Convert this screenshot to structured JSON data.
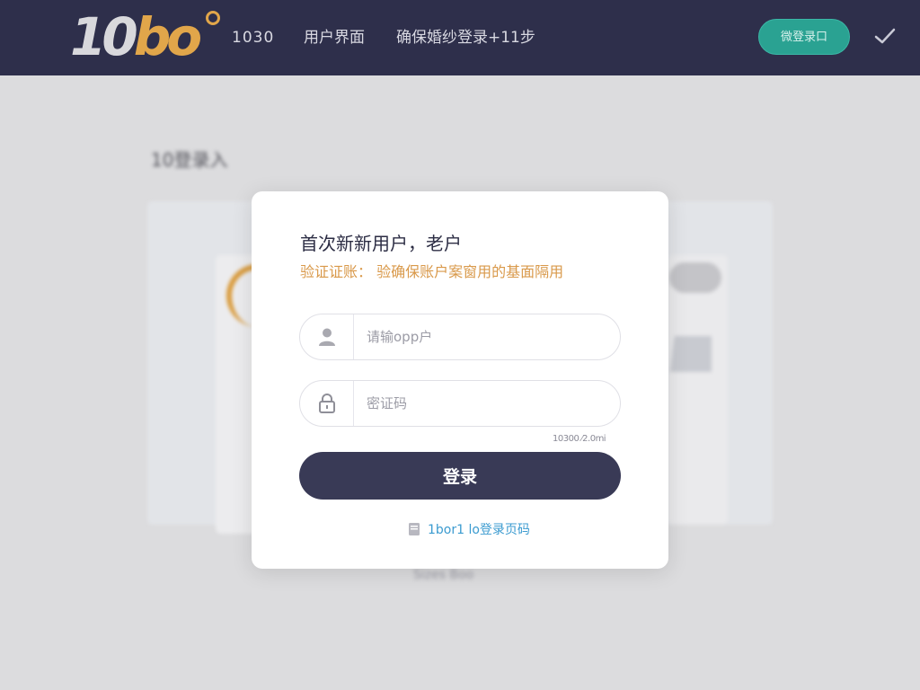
{
  "header": {
    "logo_main": "10",
    "logo_accent": "bo",
    "nav": [
      "1030",
      "用户界面",
      "确保婚纱登录+11步"
    ],
    "login_button": "微登录口"
  },
  "background": {
    "heading": "10登录入",
    "footer": "Sizes Boo"
  },
  "modal": {
    "title": "首次新新用户，老户",
    "subtitle": "验证证账：  验确保账户案窗用的基面隔用",
    "username_placeholder": "请输opp户",
    "password_placeholder": "密证码",
    "hint": "10300 ⁄2.0mi",
    "login_label": "登录",
    "footer_link": "1bor1 lo登录页码"
  },
  "colors": {
    "header_bg": "#2e2f4b",
    "accent": "#e1a64a",
    "login_button": "#393a56",
    "pill_green": "#2aa292",
    "link": "#3b9bd0"
  }
}
